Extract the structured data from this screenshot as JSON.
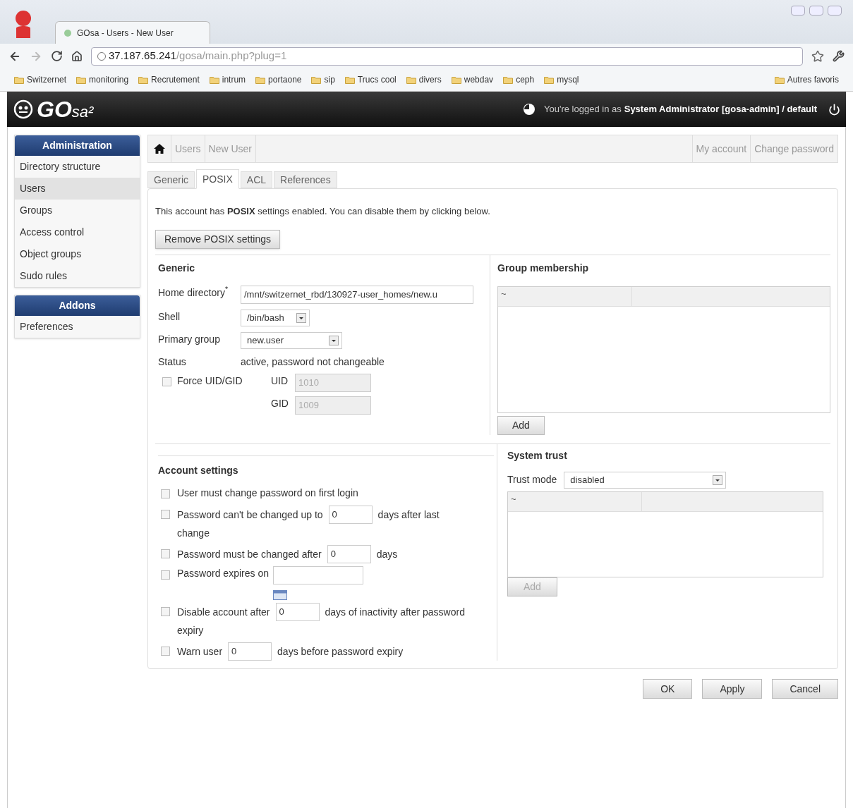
{
  "browser": {
    "tab_title": "GOsa - Users - New User",
    "url_host": "37.187.65.241",
    "url_path": "/gosa/main.php?plug=1",
    "bookmarks": [
      "Switzernet",
      "monitoring",
      "Recrutement",
      "intrum",
      "portaone",
      "sip",
      "Trucs cool",
      "divers",
      "webdav",
      "ceph",
      "mysql"
    ],
    "other_bookmarks": "Autres favoris"
  },
  "header": {
    "logo_main": "GO",
    "logo_sub": "sa²",
    "login_prefix": "You're logged in as",
    "login_user": "System Administrator [gosa-admin] / default"
  },
  "sidebar": [
    {
      "title": "Administration",
      "items": [
        {
          "label": "Directory structure",
          "selected": false
        },
        {
          "label": "Users",
          "selected": true
        },
        {
          "label": "Groups",
          "selected": false
        },
        {
          "label": "Access control",
          "selected": false
        },
        {
          "label": "Object groups",
          "selected": false
        },
        {
          "label": "Sudo rules",
          "selected": false
        }
      ]
    },
    {
      "title": "Addons",
      "items": [
        {
          "label": "Preferences",
          "selected": false
        }
      ]
    }
  ],
  "breadcrumb": [
    "Users",
    "New User"
  ],
  "top_links": [
    "My account",
    "Change password"
  ],
  "tabs": [
    {
      "label": "Generic",
      "selected": false
    },
    {
      "label": "POSIX",
      "selected": true
    },
    {
      "label": "ACL",
      "selected": false
    },
    {
      "label": "References",
      "selected": false
    }
  ],
  "notice": "This account has **POSIX** settings enabled. You can disable them by clicking below.",
  "remove_button": "Remove POSIX settings",
  "generic": {
    "title": "Generic",
    "home_label": "Home directory$^{*}$",
    "home_value": "/mnt/switzernet_rbd/130927-user_homes/new.u",
    "shell_label": "Shell",
    "shell_value": "/bin/bash",
    "group_label": "Primary group",
    "group_value": "new.user",
    "status_label": "Status",
    "status_value": "active, password not changeable",
    "force_label": "Force UID/GID",
    "force_checked": false,
    "uid_label": "UID",
    "uid_value": "1010",
    "gid_label": "GID",
    "gid_value": "1009",
    "ids_disabled": true
  },
  "group_membership": {
    "title": "Group membership",
    "column_1": "~",
    "add_button": "Add"
  },
  "account_settings": {
    "title": "Account settings",
    "rows": [
      {
        "kind": "plain",
        "checked": false,
        "text": "User must change password on first login"
      },
      {
        "kind": "number",
        "checked": false,
        "before": "Password can't be changed up to",
        "value": "0",
        "after": "days after last",
        "after_line_2": "change"
      },
      {
        "kind": "number",
        "checked": false,
        "before": "Password must be changed after",
        "value": "0",
        "after": "days"
      },
      {
        "kind": "date",
        "checked": false,
        "before": "Password expires on"
      },
      {
        "kind": "number",
        "checked": false,
        "before": "Disable account after",
        "value": "0",
        "after": "days of inactivity after password",
        "after_line_2": "expiry"
      },
      {
        "kind": "number",
        "checked": false,
        "before": "Warn user",
        "value": "0",
        "after": "days before password expiry"
      }
    ]
  },
  "system_trust": {
    "title": "System trust",
    "mode_label": "Trust mode",
    "mode_value": "disabled",
    "column_1": "~",
    "add_button": "Add",
    "add_disabled": true
  },
  "buttons": [
    "OK",
    "Apply",
    "Cancel"
  ]
}
